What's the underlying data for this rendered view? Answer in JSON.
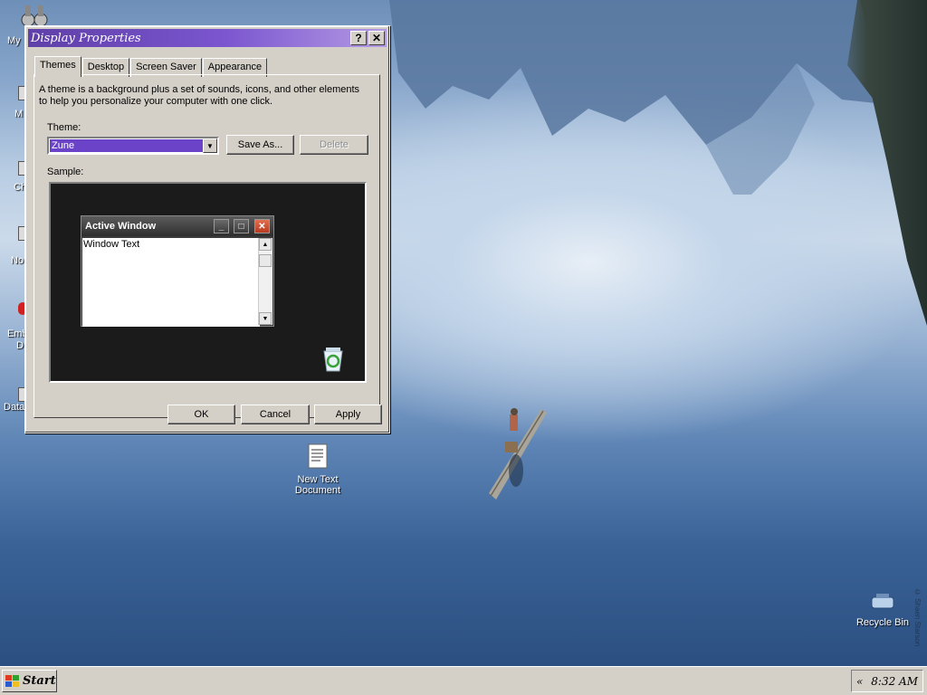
{
  "desktop": {
    "left_icons": [
      {
        "label": "My",
        "name": "desktop-icon-my-documents"
      },
      {
        "label": "M",
        "name": "desktop-icon-my-computer"
      },
      {
        "label": "Ch",
        "name": "desktop-icon-ch"
      },
      {
        "label": "No",
        "name": "desktop-icon-notepad"
      },
      {
        "label": "Emb",
        "name": "desktop-icon-emb-line1"
      },
      {
        "label": "D",
        "name": "desktop-icon-emb-line2"
      },
      {
        "label": "Data",
        "name": "desktop-icon-data"
      }
    ],
    "text_doc_line1": "New Text",
    "text_doc_line2": "Document",
    "recycle_bin": "Recycle Bin",
    "watermark": "© Shaen Starson"
  },
  "dialog": {
    "title": "Display Properties",
    "help_btn": "?",
    "close_btn": "✕",
    "tabs": [
      "Themes",
      "Desktop",
      "Screen Saver",
      "Appearance"
    ],
    "description": "A theme is a background plus a set of sounds, icons, and other elements to help you personalize your computer with one click.",
    "theme_label": "Theme:",
    "theme_value": "Zune",
    "save_as": "Save As...",
    "delete": "Delete",
    "sample_label": "Sample:",
    "sample": {
      "window_title": "Active Window",
      "window_text": "Window Text"
    },
    "ok": "OK",
    "cancel": "Cancel",
    "apply": "Apply"
  },
  "taskbar": {
    "start": "Start",
    "tray_arrow": "«",
    "clock": "8:32 AM"
  }
}
